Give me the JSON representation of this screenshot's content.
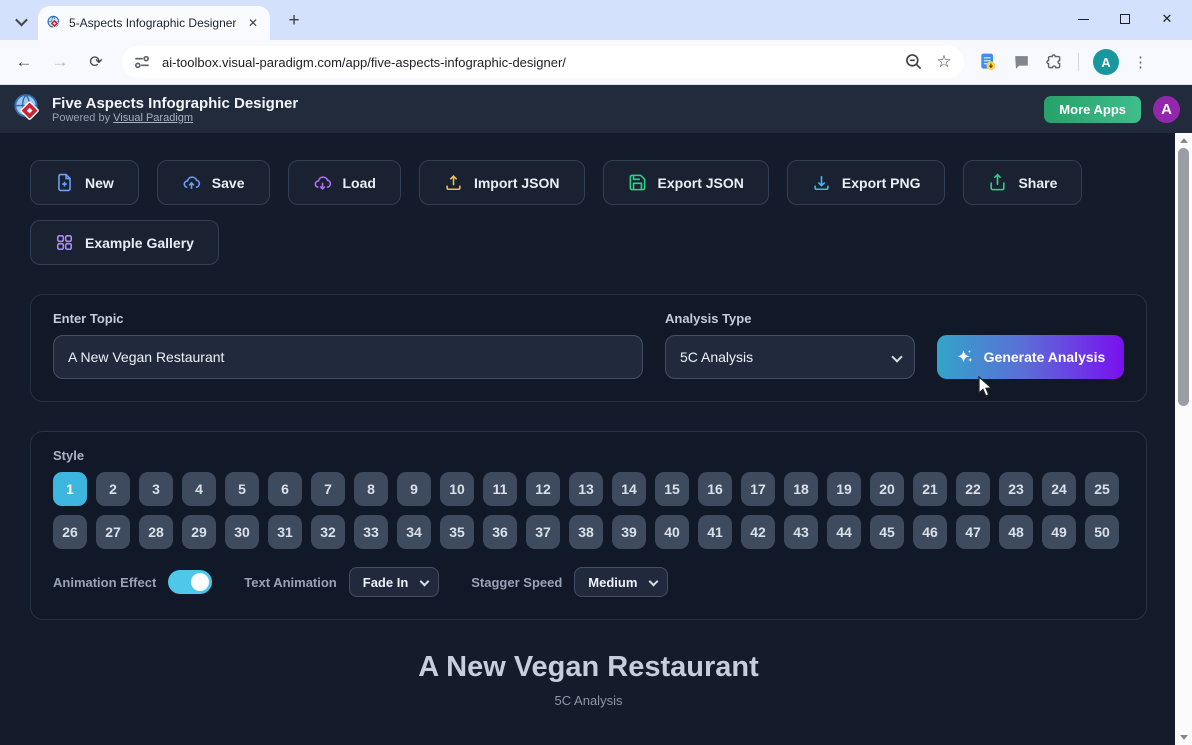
{
  "browser": {
    "tab_title": "5-Aspects Infographic Designer",
    "url": "ai-toolbox.visual-paradigm.com/app/five-aspects-infographic-designer/",
    "profile_initial": "A"
  },
  "header": {
    "title": "Five Aspects Infographic Designer",
    "powered_by_prefix": "Powered by ",
    "powered_by_link": "Visual Paradigm",
    "more_apps_label": "More Apps",
    "avatar_initial": "A",
    "more_apps_color": "#2faf7a",
    "background_color": "#212b3b"
  },
  "toolbar": {
    "buttons": [
      {
        "label": "New",
        "icon": "file-plus-icon",
        "color": "#6c9ef8"
      },
      {
        "label": "Save",
        "icon": "cloud-upload-icon",
        "color": "#6c9ef8"
      },
      {
        "label": "Load",
        "icon": "cloud-download-icon",
        "color": "#b26ef5"
      },
      {
        "label": "Import JSON",
        "icon": "upload-icon",
        "color": "#e8c254"
      },
      {
        "label": "Export JSON",
        "icon": "save-disk-icon",
        "color": "#2fd08c"
      },
      {
        "label": "Export PNG",
        "icon": "download-icon",
        "color": "#38bdf8"
      },
      {
        "label": "Share",
        "icon": "share-icon",
        "color": "#2fd08c"
      },
      {
        "label": "Example Gallery",
        "icon": "grid-icon",
        "color": "#a78bfa"
      }
    ]
  },
  "topic_panel": {
    "topic_label": "Enter Topic",
    "topic_value": "A New Vegan Restaurant",
    "analysis_type_label": "Analysis Type",
    "analysis_type_value": "5C Analysis",
    "generate_label": "Generate Analysis",
    "generate_gradient": [
      "#33a4c8",
      "#7a10ef"
    ]
  },
  "style_panel": {
    "label": "Style",
    "styles": [
      "1",
      "2",
      "3",
      "4",
      "5",
      "6",
      "7",
      "8",
      "9",
      "10",
      "11",
      "12",
      "13",
      "14",
      "15",
      "16",
      "17",
      "18",
      "19",
      "20",
      "21",
      "22",
      "23",
      "24",
      "25",
      "26",
      "27",
      "28",
      "29",
      "30",
      "31",
      "32",
      "33",
      "34",
      "35",
      "36",
      "37",
      "38",
      "39",
      "40",
      "41",
      "42",
      "43",
      "44",
      "45",
      "46",
      "47",
      "48",
      "49",
      "50"
    ],
    "selected_style": "1",
    "selected_color": "#3cb6df",
    "animation_effect_label": "Animation Effect",
    "animation_on": true,
    "toggle_color": "#4ec7ea",
    "text_animation_label": "Text Animation",
    "text_animation_value": "Fade In",
    "stagger_speed_label": "Stagger Speed",
    "stagger_speed_value": "Medium"
  },
  "preview": {
    "title": "A New Vegan Restaurant",
    "subtitle": "5C Analysis"
  }
}
